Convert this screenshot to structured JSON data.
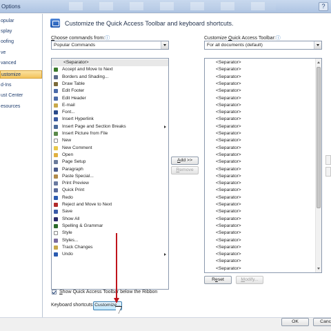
{
  "window": {
    "title": "Options"
  },
  "nav": {
    "items": [
      {
        "label": "opular"
      },
      {
        "label": "splay"
      },
      {
        "label": "oofing"
      },
      {
        "label": "ve"
      },
      {
        "label": "vanced"
      },
      {
        "label": "ustomize",
        "selected": true
      },
      {
        "label": "d-Ins"
      },
      {
        "label": "ust Center"
      },
      {
        "label": "esources"
      }
    ]
  },
  "header": {
    "text": "Customize the Quick Access Toolbar and keyboard shortcuts."
  },
  "choose": {
    "label_pre": "",
    "label_u": "C",
    "label_post": "hoose commands from:",
    "info_icon": "ⓘ",
    "value": "Popular Commands"
  },
  "customize_qat": {
    "label_pre": "Customize ",
    "label_u": "Q",
    "label_post": "uick Access Toolbar:",
    "info_icon": "ⓘ",
    "value": "For all documents (default)"
  },
  "commands": [
    {
      "label": "<Separator>",
      "sep": true
    },
    {
      "label": "Accept and Move to Next",
      "color": "#3a7a2a"
    },
    {
      "label": "Borders and Shading...",
      "color": "#5a6a8a"
    },
    {
      "label": "Draw Table",
      "color": "#7a6a3a"
    },
    {
      "label": "Edit Footer",
      "color": "#4a6aa8"
    },
    {
      "label": "Edit Header",
      "color": "#4a6aa8"
    },
    {
      "label": "E-mail",
      "color": "#c8a84a"
    },
    {
      "label": "Font...",
      "color": "#2a4a8a"
    },
    {
      "label": "Insert Hyperlink",
      "color": "#3a5aa0"
    },
    {
      "label": "Insert Page and Section Breaks",
      "color": "#4a6a9a",
      "submenu": true
    },
    {
      "label": "Insert Picture from File",
      "color": "#5a8a4a"
    },
    {
      "label": "New",
      "color": "#ffffff"
    },
    {
      "label": "New Comment",
      "color": "#e8c84a"
    },
    {
      "label": "Open",
      "color": "#e0b040"
    },
    {
      "label": "Page Setup",
      "color": "#6a7a9a"
    },
    {
      "label": "Paragraph",
      "color": "#4a5a8a"
    },
    {
      "label": "Paste Special...",
      "color": "#b08a4a"
    },
    {
      "label": "Print Preview",
      "color": "#6a7aa0"
    },
    {
      "label": "Quick Print",
      "color": "#5a6a9a"
    },
    {
      "label": "Redo",
      "color": "#2a5ab0"
    },
    {
      "label": "Reject and Move to Next",
      "color": "#b02a2a"
    },
    {
      "label": "Save",
      "color": "#3a5aa8"
    },
    {
      "label": "Show All",
      "color": "#2a2a6a"
    },
    {
      "label": "Spelling & Grammar",
      "color": "#2a6a2a"
    },
    {
      "label": "Style",
      "color": "#ffffff"
    },
    {
      "label": "Styles...",
      "color": "#7a6aa0"
    },
    {
      "label": "Track Changes",
      "color": "#c8a84a"
    },
    {
      "label": "Undo",
      "color": "#2a5ab0",
      "submenu": true
    }
  ],
  "qat_items": [
    "<Separator>",
    "<Separator>",
    "<Separator>",
    "<Separator>",
    "<Separator>",
    "<Separator>",
    "<Separator>",
    "<Separator>",
    "<Separator>",
    "<Separator>",
    "<Separator>",
    "<Separator>",
    "<Separator>",
    "<Separator>",
    "<Separator>",
    "<Separator>",
    "<Separator>",
    "<Separator>",
    "<Separator>",
    "<Separator>",
    "<Separator>",
    "<Separator>",
    "<Separator>",
    "<Separator>",
    "<Separator>",
    "<Separator>",
    "<Separator>",
    "<Separator>",
    "<Separator>",
    "<Separator>"
  ],
  "buttons": {
    "add": {
      "pre": "",
      "u": "A",
      "post": "dd >>"
    },
    "remove": {
      "pre": "",
      "u": "R",
      "post": "emove"
    },
    "reset": {
      "pre": "R",
      "u": "e",
      "post": "set"
    },
    "modify": {
      "pre": "",
      "u": "M",
      "post": "odify..."
    },
    "customize": "Customize...",
    "ok": "OK",
    "cancel": "Cance"
  },
  "show_below": {
    "pre": "",
    "u": "S",
    "post": "how Quick Access Toolbar below the Ribbon",
    "checked": true
  },
  "keyboard_label": "Keyboard shortcuts:",
  "colors": {
    "selected_nav": "#f3c35c",
    "annotation_arrow": "#c0141b",
    "accent": "#1f3d6e"
  }
}
